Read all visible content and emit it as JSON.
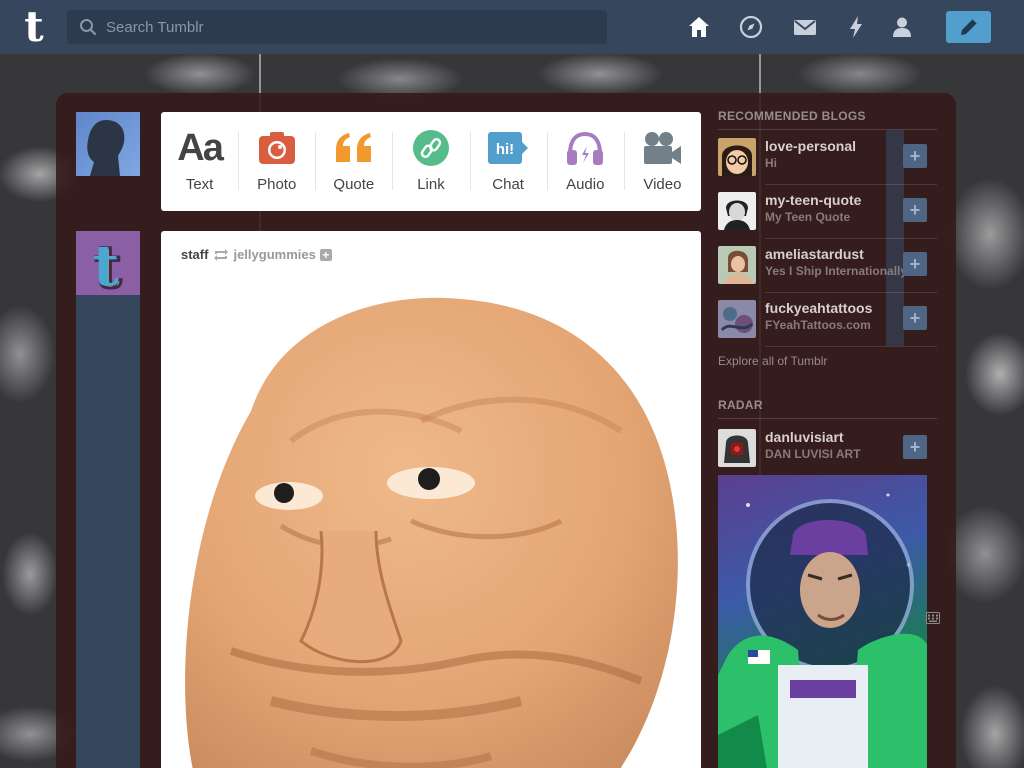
{
  "header": {
    "logo": "t",
    "search_placeholder": "Search Tumblr",
    "nav": [
      "home-icon",
      "explore-icon",
      "inbox-icon",
      "activity-icon",
      "account-icon"
    ],
    "compose_icon": "pencil-icon",
    "bar_color": "#36465d",
    "compose_color": "#529ecc"
  },
  "composer": {
    "types": [
      {
        "label": "Text",
        "icon": "text-icon",
        "color": "#444444"
      },
      {
        "label": "Photo",
        "icon": "camera-icon",
        "color": "#d95e40"
      },
      {
        "label": "Quote",
        "icon": "quote-icon",
        "color": "#f2992e"
      },
      {
        "label": "Link",
        "icon": "link-icon",
        "color": "#56bc8a"
      },
      {
        "label": "Chat",
        "icon": "chat-icon",
        "color": "#529ecc"
      },
      {
        "label": "Audio",
        "icon": "headphones-icon",
        "color": "#a77dc2"
      },
      {
        "label": "Video",
        "icon": "video-camera-icon",
        "color": "#748089"
      }
    ]
  },
  "post": {
    "author": "staff",
    "source": "jellygummies",
    "follow": "+"
  },
  "sidebar": {
    "recommended_title": "RECOMMENDED BLOGS",
    "blogs": [
      {
        "name": "love-personal",
        "desc": "Hi"
      },
      {
        "name": "my-teen-quote",
        "desc": "My Teen Quote"
      },
      {
        "name": "ameliastardust",
        "desc": "Yes I Ship Internationally"
      },
      {
        "name": "fuckyeahtattoos",
        "desc": "FYeahTattoos.com"
      }
    ],
    "follow_label": "+",
    "explore_label": "Explore all of Tumblr",
    "radar_title": "RADAR",
    "radar": {
      "name": "danluvisiart",
      "desc": "DAN LUVISI ART"
    }
  }
}
